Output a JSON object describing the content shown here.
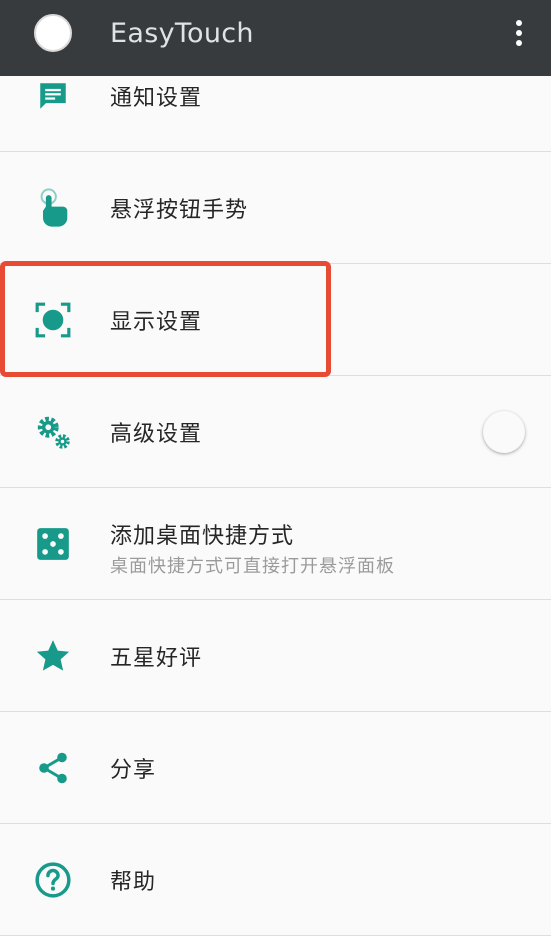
{
  "appbar": {
    "title": "EasyTouch",
    "logo_icon": "circle-logo",
    "menu_icon": "overflow-vertical-icon"
  },
  "accent_color": "#189a8a",
  "highlight_color": "#e84b33",
  "items": [
    {
      "label": "通知设置",
      "icon": "message-icon"
    },
    {
      "label": "悬浮按钮手势",
      "icon": "touch-hand-icon"
    },
    {
      "label": "显示设置",
      "icon": "display-focus-icon",
      "highlighted": true
    },
    {
      "label": "高级设置",
      "icon": "gears-icon",
      "toggle": false
    },
    {
      "label": "添加桌面快捷方式",
      "sublabel": "桌面快捷方式可直接打开悬浮面板",
      "icon": "dice-icon"
    },
    {
      "label": "五星好评",
      "icon": "star-icon"
    },
    {
      "label": "分享",
      "icon": "share-icon"
    },
    {
      "label": "帮助",
      "icon": "help-icon"
    }
  ]
}
